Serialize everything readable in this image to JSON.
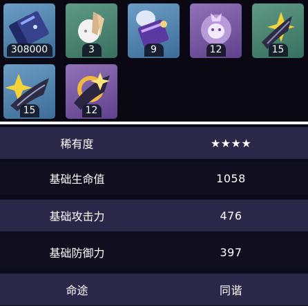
{
  "items": [
    {
      "name": "credit",
      "count": "308000",
      "rarity": "blue"
    },
    {
      "name": "material-mask",
      "count": "3",
      "rarity": "green"
    },
    {
      "name": "material-scroll",
      "count": "9",
      "rarity": "blue"
    },
    {
      "name": "material-spirit",
      "count": "12",
      "rarity": "purple"
    },
    {
      "name": "material-blade-green",
      "count": "15",
      "rarity": "green"
    },
    {
      "name": "material-blade-blue",
      "count": "15",
      "rarity": "blue"
    },
    {
      "name": "material-blade-purple",
      "count": "12",
      "rarity": "purple"
    }
  ],
  "stats": [
    {
      "label": "稀有度",
      "value": "★★★★"
    },
    {
      "label": "基础生命值",
      "value": "1058"
    },
    {
      "label": "基础攻击力",
      "value": "476"
    },
    {
      "label": "基础防御力",
      "value": "397"
    },
    {
      "label": "命途",
      "value": "同谐"
    }
  ]
}
